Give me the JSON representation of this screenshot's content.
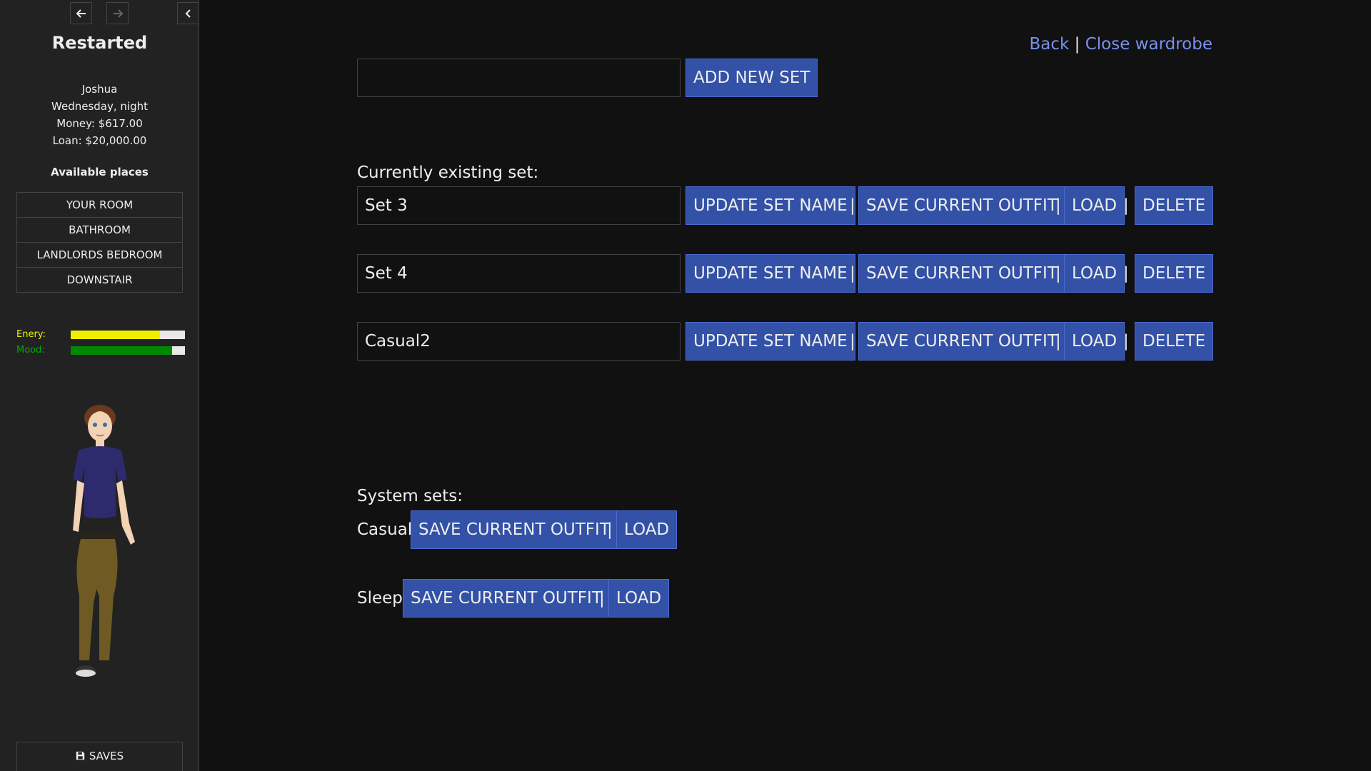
{
  "sidebar": {
    "title": "Restarted",
    "caption": {
      "name": "Joshua",
      "time": "Wednesday, night",
      "money": "Money: $617.00",
      "loan": "Loan: $20,000.00"
    },
    "places_heading": "Available places",
    "places": [
      "YOUR ROOM",
      "BATHROOM",
      "LANDLORDS BEDROOM",
      "DOWNSTAIR"
    ],
    "stats": [
      {
        "label": "Enery:",
        "value": 0.78,
        "color": "#eeee00"
      },
      {
        "label": "Mood:",
        "value": 0.89,
        "color": "#008800"
      }
    ],
    "saves_label": "SAVES"
  },
  "main": {
    "back_link": "Back",
    "separator": "|",
    "close_link": "Close wardrobe",
    "new_set_input": "",
    "add_new_set": "ADD NEW SET",
    "existing_heading": "Currently existing set:",
    "existing_sets": [
      {
        "name": "Set 3"
      },
      {
        "name": "Set 4"
      },
      {
        "name": "Casual2"
      }
    ],
    "update_label": "UPDATE SET NAME",
    "save_outfit_label": "SAVE CURRENT OUTFIT",
    "load_label": "LOAD",
    "delete_label": "DELETE",
    "system_heading": "System sets:",
    "system_sets": [
      {
        "name": "Casual"
      },
      {
        "name": "Sleep"
      }
    ]
  },
  "colors": {
    "background": "#111112",
    "sidebar": "#222222",
    "button": "#3251a7",
    "link": "#7891ee"
  }
}
